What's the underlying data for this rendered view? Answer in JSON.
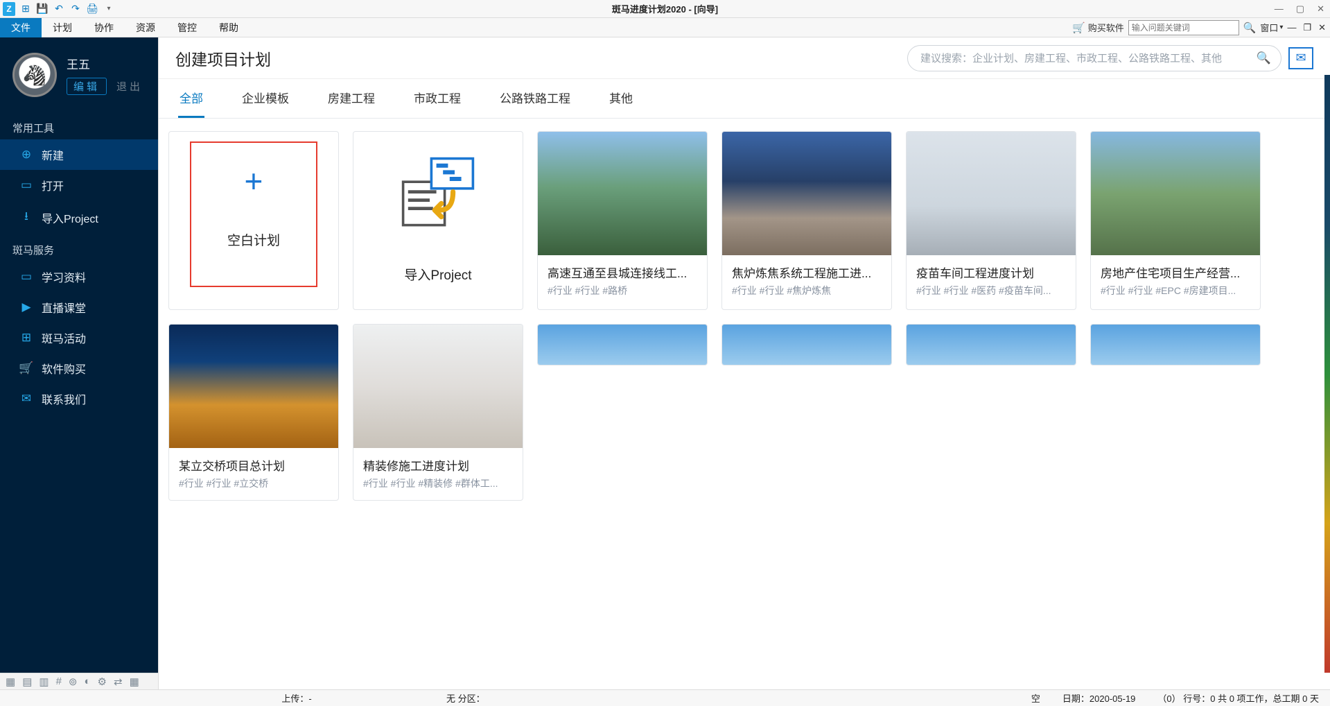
{
  "titlebar": {
    "title": "斑马进度计划2020 - [向导]",
    "logo_letter": "Z"
  },
  "qat": {
    "new": "⊞",
    "save": "💾",
    "undo": "↶",
    "redo": "↷",
    "print": "🖨",
    "drop": "▾"
  },
  "menubar": {
    "items": [
      "文件",
      "计划",
      "协作",
      "资源",
      "管控",
      "帮助"
    ],
    "buy": "购买软件",
    "search_placeholder": "输入问题关键词",
    "window_label": "窗口"
  },
  "user": {
    "name": "王五",
    "edit": "编辑",
    "exit": "退出"
  },
  "sidebar": {
    "section1": "常用工具",
    "items1": [
      {
        "icon": "⊕",
        "label": "新建",
        "active": true
      },
      {
        "icon": "▭",
        "label": "打开"
      },
      {
        "icon": "⭳",
        "label": "导入Project"
      }
    ],
    "section2": "斑马服务",
    "items2": [
      {
        "icon": "▭",
        "label": "学习资料"
      },
      {
        "icon": "▶",
        "label": "直播课堂"
      },
      {
        "icon": "⊞",
        "label": "斑马活动"
      },
      {
        "icon": "🛒",
        "label": "软件购买"
      },
      {
        "icon": "✉",
        "label": "联系我们"
      }
    ]
  },
  "main": {
    "title": "创建项目计划",
    "search_placeholder": "建议搜索：企业计划、房建工程、市政工程、公路铁路工程、其他",
    "tabs": [
      "全部",
      "企业模板",
      "房建工程",
      "市政工程",
      "公路铁路工程",
      "其他"
    ]
  },
  "cards": [
    {
      "kind": "blank",
      "title": "空白计划"
    },
    {
      "kind": "import",
      "title": "导入Project"
    },
    {
      "kind": "img",
      "cls": "img-a",
      "title": "高速互通至县城连接线工...",
      "tags": "#行业 #行业 #路桥"
    },
    {
      "kind": "img",
      "cls": "img-b",
      "title": "焦炉炼焦系统工程施工进...",
      "tags": "#行业 #行业 #焦炉炼焦"
    },
    {
      "kind": "img",
      "cls": "img-c",
      "title": "疫苗车间工程进度计划",
      "tags": "#行业 #行业 #医药 #疫苗车间..."
    },
    {
      "kind": "img",
      "cls": "img-d",
      "title": "房地产住宅项目生产经营...",
      "tags": "#行业 #行业 #EPC #房建项目..."
    },
    {
      "kind": "img",
      "cls": "img-e",
      "title": "某立交桥项目总计划",
      "tags": "#行业 #行业 #立交桥"
    },
    {
      "kind": "img",
      "cls": "img-f",
      "title": "精装修施工进度计划",
      "tags": "#行业 #行业 #精装修 #群体工..."
    },
    {
      "kind": "img",
      "cls": "img-g",
      "title": "",
      "tags": ""
    },
    {
      "kind": "img",
      "cls": "img-g",
      "title": "",
      "tags": ""
    },
    {
      "kind": "img",
      "cls": "img-g",
      "title": "",
      "tags": ""
    },
    {
      "kind": "img",
      "cls": "img-g",
      "title": "",
      "tags": ""
    }
  ],
  "status": {
    "upload": "上传：-",
    "zone": "无   分区：",
    "empty": "空",
    "date_label": "日期：",
    "date": "2020-05-19",
    "tail": "（0） 行号：0  共    0    项工作，总工期   0    天"
  }
}
